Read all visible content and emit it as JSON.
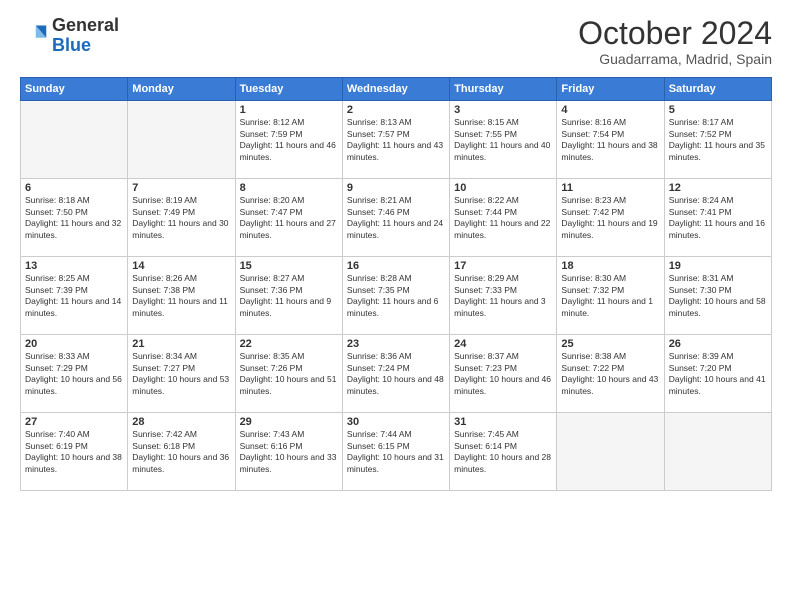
{
  "header": {
    "logo_general": "General",
    "logo_blue": "Blue",
    "month_title": "October 2024",
    "location": "Guadarrama, Madrid, Spain"
  },
  "weekdays": [
    "Sunday",
    "Monday",
    "Tuesday",
    "Wednesday",
    "Thursday",
    "Friday",
    "Saturday"
  ],
  "weeks": [
    [
      {
        "day": "",
        "empty": true
      },
      {
        "day": "",
        "empty": true
      },
      {
        "day": "1",
        "sunrise": "Sunrise: 8:12 AM",
        "sunset": "Sunset: 7:59 PM",
        "daylight": "Daylight: 11 hours and 46 minutes."
      },
      {
        "day": "2",
        "sunrise": "Sunrise: 8:13 AM",
        "sunset": "Sunset: 7:57 PM",
        "daylight": "Daylight: 11 hours and 43 minutes."
      },
      {
        "day": "3",
        "sunrise": "Sunrise: 8:15 AM",
        "sunset": "Sunset: 7:55 PM",
        "daylight": "Daylight: 11 hours and 40 minutes."
      },
      {
        "day": "4",
        "sunrise": "Sunrise: 8:16 AM",
        "sunset": "Sunset: 7:54 PM",
        "daylight": "Daylight: 11 hours and 38 minutes."
      },
      {
        "day": "5",
        "sunrise": "Sunrise: 8:17 AM",
        "sunset": "Sunset: 7:52 PM",
        "daylight": "Daylight: 11 hours and 35 minutes."
      }
    ],
    [
      {
        "day": "6",
        "sunrise": "Sunrise: 8:18 AM",
        "sunset": "Sunset: 7:50 PM",
        "daylight": "Daylight: 11 hours and 32 minutes."
      },
      {
        "day": "7",
        "sunrise": "Sunrise: 8:19 AM",
        "sunset": "Sunset: 7:49 PM",
        "daylight": "Daylight: 11 hours and 30 minutes."
      },
      {
        "day": "8",
        "sunrise": "Sunrise: 8:20 AM",
        "sunset": "Sunset: 7:47 PM",
        "daylight": "Daylight: 11 hours and 27 minutes."
      },
      {
        "day": "9",
        "sunrise": "Sunrise: 8:21 AM",
        "sunset": "Sunset: 7:46 PM",
        "daylight": "Daylight: 11 hours and 24 minutes."
      },
      {
        "day": "10",
        "sunrise": "Sunrise: 8:22 AM",
        "sunset": "Sunset: 7:44 PM",
        "daylight": "Daylight: 11 hours and 22 minutes."
      },
      {
        "day": "11",
        "sunrise": "Sunrise: 8:23 AM",
        "sunset": "Sunset: 7:42 PM",
        "daylight": "Daylight: 11 hours and 19 minutes."
      },
      {
        "day": "12",
        "sunrise": "Sunrise: 8:24 AM",
        "sunset": "Sunset: 7:41 PM",
        "daylight": "Daylight: 11 hours and 16 minutes."
      }
    ],
    [
      {
        "day": "13",
        "sunrise": "Sunrise: 8:25 AM",
        "sunset": "Sunset: 7:39 PM",
        "daylight": "Daylight: 11 hours and 14 minutes."
      },
      {
        "day": "14",
        "sunrise": "Sunrise: 8:26 AM",
        "sunset": "Sunset: 7:38 PM",
        "daylight": "Daylight: 11 hours and 11 minutes."
      },
      {
        "day": "15",
        "sunrise": "Sunrise: 8:27 AM",
        "sunset": "Sunset: 7:36 PM",
        "daylight": "Daylight: 11 hours and 9 minutes."
      },
      {
        "day": "16",
        "sunrise": "Sunrise: 8:28 AM",
        "sunset": "Sunset: 7:35 PM",
        "daylight": "Daylight: 11 hours and 6 minutes."
      },
      {
        "day": "17",
        "sunrise": "Sunrise: 8:29 AM",
        "sunset": "Sunset: 7:33 PM",
        "daylight": "Daylight: 11 hours and 3 minutes."
      },
      {
        "day": "18",
        "sunrise": "Sunrise: 8:30 AM",
        "sunset": "Sunset: 7:32 PM",
        "daylight": "Daylight: 11 hours and 1 minute."
      },
      {
        "day": "19",
        "sunrise": "Sunrise: 8:31 AM",
        "sunset": "Sunset: 7:30 PM",
        "daylight": "Daylight: 10 hours and 58 minutes."
      }
    ],
    [
      {
        "day": "20",
        "sunrise": "Sunrise: 8:33 AM",
        "sunset": "Sunset: 7:29 PM",
        "daylight": "Daylight: 10 hours and 56 minutes."
      },
      {
        "day": "21",
        "sunrise": "Sunrise: 8:34 AM",
        "sunset": "Sunset: 7:27 PM",
        "daylight": "Daylight: 10 hours and 53 minutes."
      },
      {
        "day": "22",
        "sunrise": "Sunrise: 8:35 AM",
        "sunset": "Sunset: 7:26 PM",
        "daylight": "Daylight: 10 hours and 51 minutes."
      },
      {
        "day": "23",
        "sunrise": "Sunrise: 8:36 AM",
        "sunset": "Sunset: 7:24 PM",
        "daylight": "Daylight: 10 hours and 48 minutes."
      },
      {
        "day": "24",
        "sunrise": "Sunrise: 8:37 AM",
        "sunset": "Sunset: 7:23 PM",
        "daylight": "Daylight: 10 hours and 46 minutes."
      },
      {
        "day": "25",
        "sunrise": "Sunrise: 8:38 AM",
        "sunset": "Sunset: 7:22 PM",
        "daylight": "Daylight: 10 hours and 43 minutes."
      },
      {
        "day": "26",
        "sunrise": "Sunrise: 8:39 AM",
        "sunset": "Sunset: 7:20 PM",
        "daylight": "Daylight: 10 hours and 41 minutes."
      }
    ],
    [
      {
        "day": "27",
        "sunrise": "Sunrise: 7:40 AM",
        "sunset": "Sunset: 6:19 PM",
        "daylight": "Daylight: 10 hours and 38 minutes."
      },
      {
        "day": "28",
        "sunrise": "Sunrise: 7:42 AM",
        "sunset": "Sunset: 6:18 PM",
        "daylight": "Daylight: 10 hours and 36 minutes."
      },
      {
        "day": "29",
        "sunrise": "Sunrise: 7:43 AM",
        "sunset": "Sunset: 6:16 PM",
        "daylight": "Daylight: 10 hours and 33 minutes."
      },
      {
        "day": "30",
        "sunrise": "Sunrise: 7:44 AM",
        "sunset": "Sunset: 6:15 PM",
        "daylight": "Daylight: 10 hours and 31 minutes."
      },
      {
        "day": "31",
        "sunrise": "Sunrise: 7:45 AM",
        "sunset": "Sunset: 6:14 PM",
        "daylight": "Daylight: 10 hours and 28 minutes."
      },
      {
        "day": "",
        "empty": true
      },
      {
        "day": "",
        "empty": true
      }
    ]
  ]
}
